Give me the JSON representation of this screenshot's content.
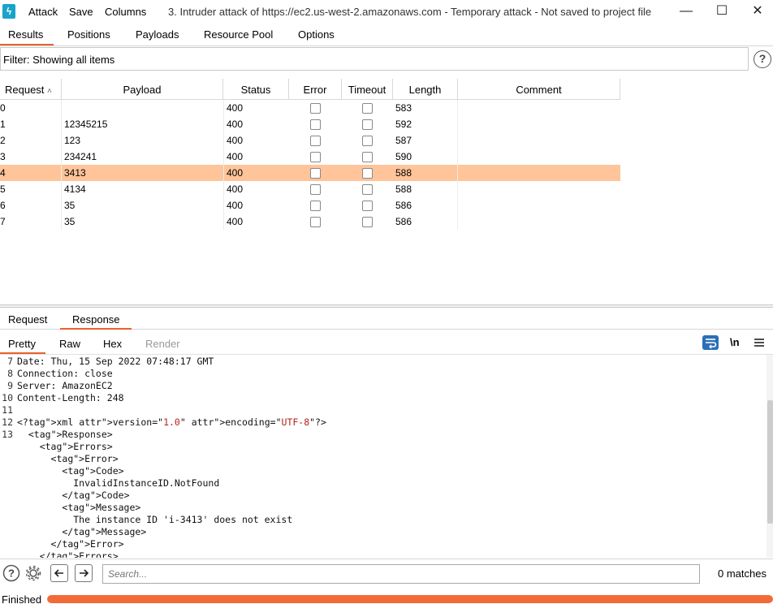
{
  "menubar": {
    "items": [
      "Attack",
      "Save",
      "Columns"
    ],
    "title": "3. Intruder attack of https://ec2.us-west-2.amazonaws.com - Temporary attack - Not saved to project file",
    "minimize": "—",
    "maximize": "☐",
    "close": "✕"
  },
  "main_tabs": [
    "Results",
    "Positions",
    "Payloads",
    "Resource Pool",
    "Options"
  ],
  "active_main_tab": "Results",
  "filter": {
    "text": "Filter: Showing all items"
  },
  "table": {
    "columns": [
      "Request",
      "Payload",
      "Status",
      "Error",
      "Timeout",
      "Length",
      "Comment"
    ],
    "sort_indicator": "^",
    "selected_row_index": 4,
    "rows": [
      {
        "request": "0",
        "payload": "",
        "status": "400",
        "error": false,
        "timeout": false,
        "length": "583",
        "comment": ""
      },
      {
        "request": "1",
        "payload": "12345215",
        "status": "400",
        "error": false,
        "timeout": false,
        "length": "592",
        "comment": ""
      },
      {
        "request": "2",
        "payload": "123",
        "status": "400",
        "error": false,
        "timeout": false,
        "length": "587",
        "comment": ""
      },
      {
        "request": "3",
        "payload": "234241",
        "status": "400",
        "error": false,
        "timeout": false,
        "length": "590",
        "comment": ""
      },
      {
        "request": "4",
        "payload": "3413",
        "status": "400",
        "error": false,
        "timeout": false,
        "length": "588",
        "comment": ""
      },
      {
        "request": "5",
        "payload": "4134",
        "status": "400",
        "error": false,
        "timeout": false,
        "length": "588",
        "comment": ""
      },
      {
        "request": "6",
        "payload": "35",
        "status": "400",
        "error": false,
        "timeout": false,
        "length": "586",
        "comment": ""
      },
      {
        "request": "7",
        "payload": "35",
        "status": "400",
        "error": false,
        "timeout": false,
        "length": "586",
        "comment": ""
      }
    ]
  },
  "detail_tabs": [
    "Request",
    "Response"
  ],
  "active_detail_tab": "Response",
  "view_tabs": [
    "Pretty",
    "Raw",
    "Hex",
    "Render"
  ],
  "active_view_tab": "Pretty",
  "view_toolbar": {
    "wrap_icon": "wrap-lines-icon",
    "newline_label": "\\n",
    "menu_icon": "hamburger-menu-icon"
  },
  "response_lines": [
    {
      "n": "7",
      "text": "Date: Thu, 15 Sep 2022 07:48:17 GMT"
    },
    {
      "n": "8",
      "text": "Connection: close"
    },
    {
      "n": "9",
      "text": "Server: AmazonEC2"
    },
    {
      "n": "10",
      "text": "Content-Length: 248"
    },
    {
      "n": "11",
      "text": ""
    },
    {
      "n": "12",
      "text": "<?xml version=\"1.0\" encoding=\"UTF-8\"?>"
    },
    {
      "n": "13",
      "text": "  <Response>"
    },
    {
      "n": "",
      "text": "    <Errors>"
    },
    {
      "n": "",
      "text": "      <Error>"
    },
    {
      "n": "",
      "text": "        <Code>"
    },
    {
      "n": "",
      "text": "          InvalidInstanceID.NotFound"
    },
    {
      "n": "",
      "text": "        </Code>"
    },
    {
      "n": "",
      "text": "        <Message>"
    },
    {
      "n": "",
      "text": "          The instance ID 'i-3413' does not exist"
    },
    {
      "n": "",
      "text": "        </Message>"
    },
    {
      "n": "",
      "text": "      </Error>"
    },
    {
      "n": "",
      "text": "    </Errors>"
    }
  ],
  "search": {
    "placeholder": "Search...",
    "value": "",
    "matches": "0 matches"
  },
  "status": {
    "text": "Finished",
    "progress": 1.0
  },
  "colors": {
    "accent": "#e8622c",
    "selected_row": "#ffc499",
    "progress": "#f26a37",
    "xml_tag": "#a31fa3",
    "xml_attr": "#1c3fa8",
    "xml_string": "#b82020"
  }
}
